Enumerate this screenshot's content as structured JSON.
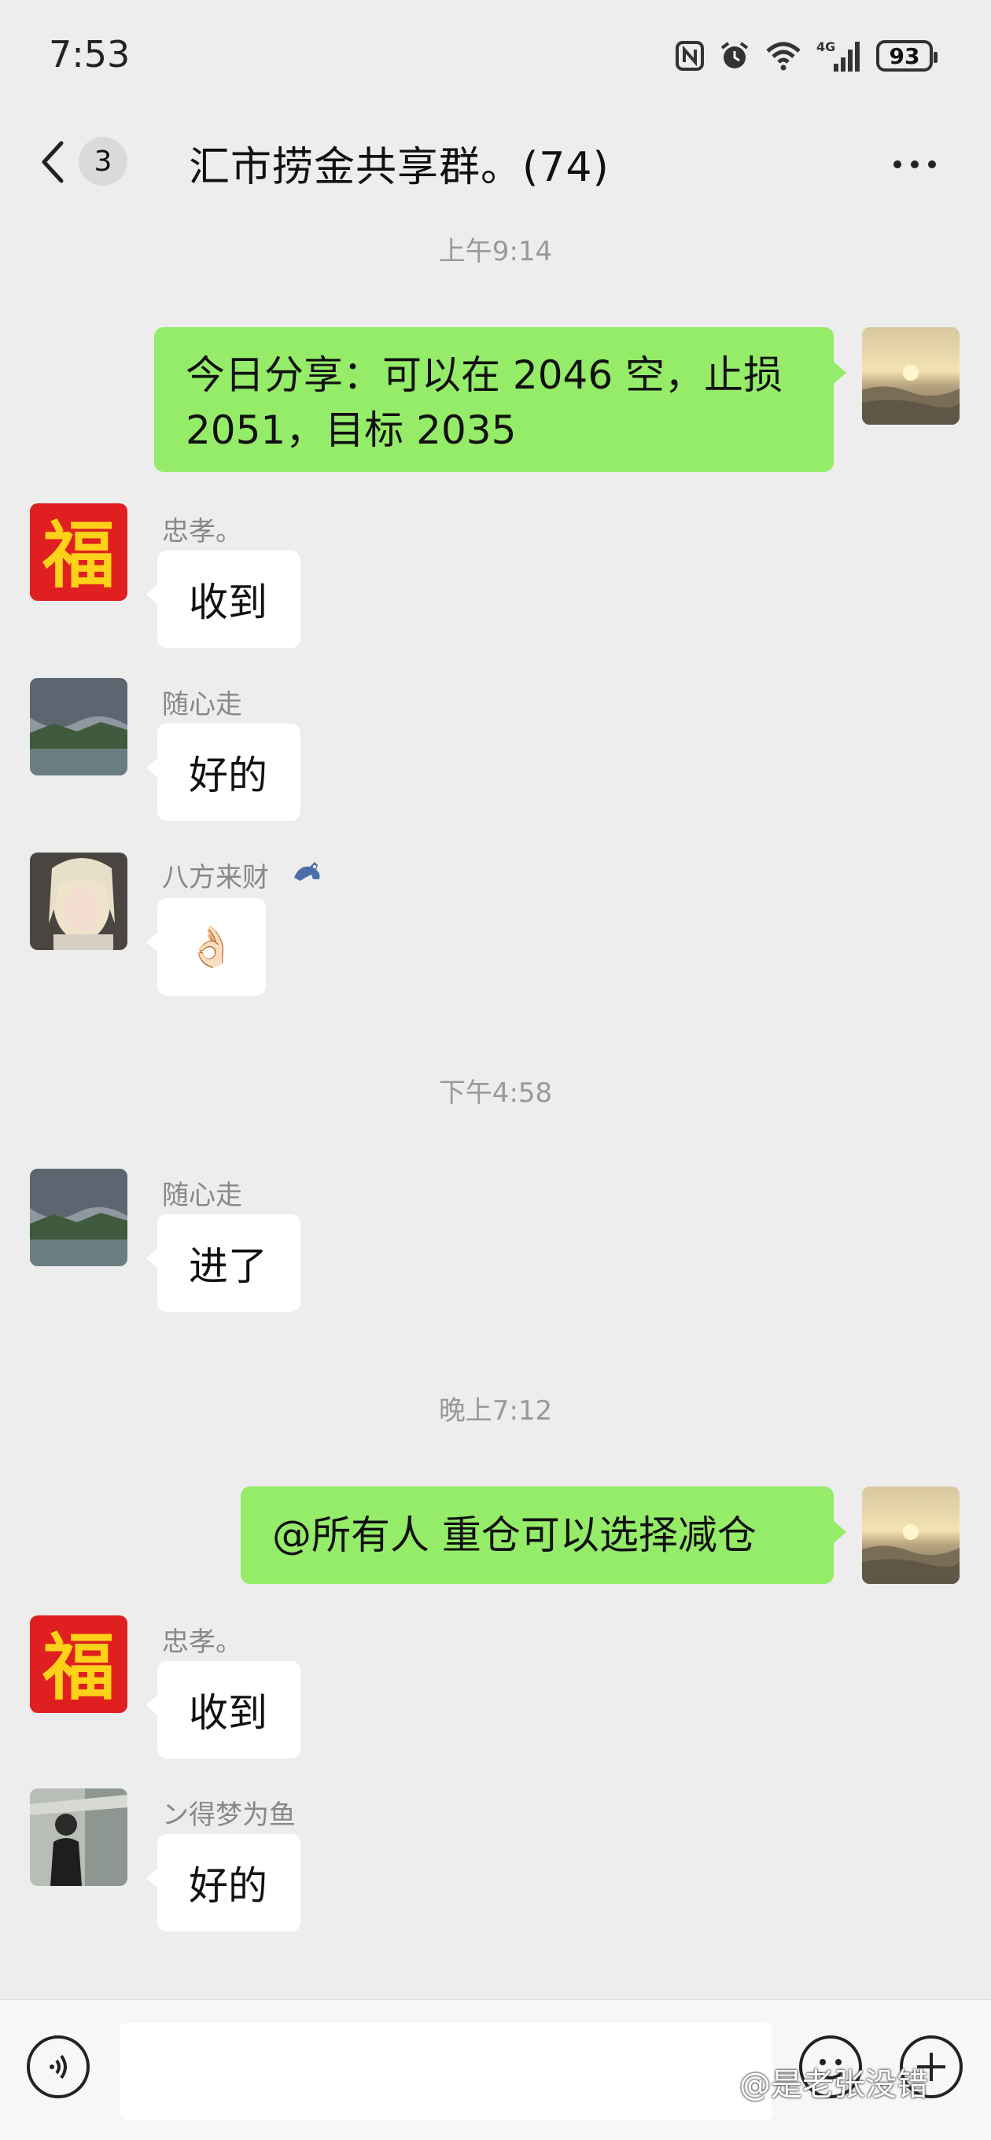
{
  "status_bar": {
    "time": "7:53",
    "battery": "93",
    "network": "4G"
  },
  "nav": {
    "back_count": "3",
    "title": "汇市捞金共享群。(74)"
  },
  "messages": [
    {
      "type": "time",
      "text": "上午9:14"
    },
    {
      "type": "out",
      "text": "今日分享：可以在 2046 空，止损 2051，目标 2035"
    },
    {
      "type": "in",
      "sender": "忠孝。",
      "text": "收到"
    },
    {
      "type": "in",
      "sender": "随心走",
      "text": "好的"
    },
    {
      "type": "in",
      "sender": "八方来财",
      "text": "👌🏻"
    },
    {
      "type": "time",
      "text": "下午4:58"
    },
    {
      "type": "in",
      "sender": "随心走",
      "text": "进了"
    },
    {
      "type": "time",
      "text": "晚上7:12"
    },
    {
      "type": "out",
      "text": "@所有人  重仓可以选择减仓"
    },
    {
      "type": "in",
      "sender": "忠孝。",
      "text": "收到"
    },
    {
      "type": "in",
      "sender": "ン得梦为鱼",
      "text": "好的"
    }
  ],
  "avatars": {
    "fu": "福"
  },
  "watermark": "@是老张没错",
  "colors": {
    "out_bubble": "#95ec69",
    "in_bubble": "#ffffff",
    "background": "#ededed"
  }
}
